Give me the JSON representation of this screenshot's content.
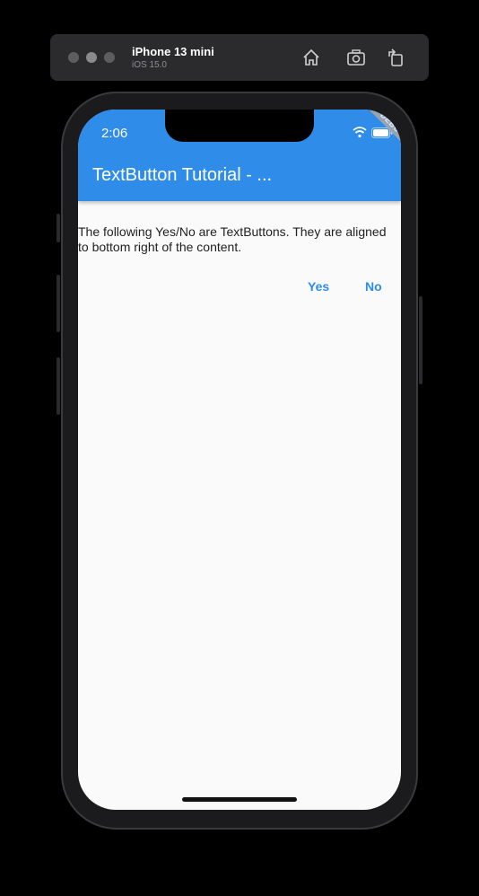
{
  "simulator": {
    "device_name": "iPhone 13 mini",
    "os_version": "iOS 15.0",
    "toolbar_icons": [
      "home-icon",
      "screenshot-icon",
      "rotate-icon"
    ]
  },
  "status_bar": {
    "time": "2:06",
    "icons": [
      "wifi-icon",
      "battery-icon"
    ]
  },
  "debug_banner": "DEBUG",
  "app_bar": {
    "title": "TextButton Tutorial - ...",
    "color": "#2f8ce9"
  },
  "content": {
    "body_text": "The following Yes/No are TextButtons. They are aligned to bottom right of the content.",
    "buttons": {
      "yes_label": "Yes",
      "no_label": "No"
    }
  },
  "colors": {
    "accent": "#2f8ce9",
    "background": "#fafafa"
  }
}
